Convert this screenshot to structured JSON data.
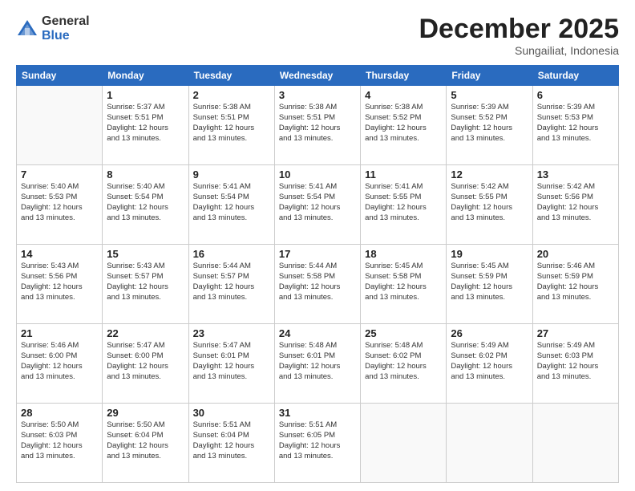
{
  "logo": {
    "general": "General",
    "blue": "Blue"
  },
  "header": {
    "month": "December 2025",
    "location": "Sungailiat, Indonesia"
  },
  "weekdays": [
    "Sunday",
    "Monday",
    "Tuesday",
    "Wednesday",
    "Thursday",
    "Friday",
    "Saturday"
  ],
  "weeks": [
    [
      {
        "day": "",
        "info": ""
      },
      {
        "day": "1",
        "info": "Sunrise: 5:37 AM\nSunset: 5:51 PM\nDaylight: 12 hours\nand 13 minutes."
      },
      {
        "day": "2",
        "info": "Sunrise: 5:38 AM\nSunset: 5:51 PM\nDaylight: 12 hours\nand 13 minutes."
      },
      {
        "day": "3",
        "info": "Sunrise: 5:38 AM\nSunset: 5:51 PM\nDaylight: 12 hours\nand 13 minutes."
      },
      {
        "day": "4",
        "info": "Sunrise: 5:38 AM\nSunset: 5:52 PM\nDaylight: 12 hours\nand 13 minutes."
      },
      {
        "day": "5",
        "info": "Sunrise: 5:39 AM\nSunset: 5:52 PM\nDaylight: 12 hours\nand 13 minutes."
      },
      {
        "day": "6",
        "info": "Sunrise: 5:39 AM\nSunset: 5:53 PM\nDaylight: 12 hours\nand 13 minutes."
      }
    ],
    [
      {
        "day": "7",
        "info": "Sunrise: 5:40 AM\nSunset: 5:53 PM\nDaylight: 12 hours\nand 13 minutes."
      },
      {
        "day": "8",
        "info": "Sunrise: 5:40 AM\nSunset: 5:54 PM\nDaylight: 12 hours\nand 13 minutes."
      },
      {
        "day": "9",
        "info": "Sunrise: 5:41 AM\nSunset: 5:54 PM\nDaylight: 12 hours\nand 13 minutes."
      },
      {
        "day": "10",
        "info": "Sunrise: 5:41 AM\nSunset: 5:54 PM\nDaylight: 12 hours\nand 13 minutes."
      },
      {
        "day": "11",
        "info": "Sunrise: 5:41 AM\nSunset: 5:55 PM\nDaylight: 12 hours\nand 13 minutes."
      },
      {
        "day": "12",
        "info": "Sunrise: 5:42 AM\nSunset: 5:55 PM\nDaylight: 12 hours\nand 13 minutes."
      },
      {
        "day": "13",
        "info": "Sunrise: 5:42 AM\nSunset: 5:56 PM\nDaylight: 12 hours\nand 13 minutes."
      }
    ],
    [
      {
        "day": "14",
        "info": "Sunrise: 5:43 AM\nSunset: 5:56 PM\nDaylight: 12 hours\nand 13 minutes."
      },
      {
        "day": "15",
        "info": "Sunrise: 5:43 AM\nSunset: 5:57 PM\nDaylight: 12 hours\nand 13 minutes."
      },
      {
        "day": "16",
        "info": "Sunrise: 5:44 AM\nSunset: 5:57 PM\nDaylight: 12 hours\nand 13 minutes."
      },
      {
        "day": "17",
        "info": "Sunrise: 5:44 AM\nSunset: 5:58 PM\nDaylight: 12 hours\nand 13 minutes."
      },
      {
        "day": "18",
        "info": "Sunrise: 5:45 AM\nSunset: 5:58 PM\nDaylight: 12 hours\nand 13 minutes."
      },
      {
        "day": "19",
        "info": "Sunrise: 5:45 AM\nSunset: 5:59 PM\nDaylight: 12 hours\nand 13 minutes."
      },
      {
        "day": "20",
        "info": "Sunrise: 5:46 AM\nSunset: 5:59 PM\nDaylight: 12 hours\nand 13 minutes."
      }
    ],
    [
      {
        "day": "21",
        "info": "Sunrise: 5:46 AM\nSunset: 6:00 PM\nDaylight: 12 hours\nand 13 minutes."
      },
      {
        "day": "22",
        "info": "Sunrise: 5:47 AM\nSunset: 6:00 PM\nDaylight: 12 hours\nand 13 minutes."
      },
      {
        "day": "23",
        "info": "Sunrise: 5:47 AM\nSunset: 6:01 PM\nDaylight: 12 hours\nand 13 minutes."
      },
      {
        "day": "24",
        "info": "Sunrise: 5:48 AM\nSunset: 6:01 PM\nDaylight: 12 hours\nand 13 minutes."
      },
      {
        "day": "25",
        "info": "Sunrise: 5:48 AM\nSunset: 6:02 PM\nDaylight: 12 hours\nand 13 minutes."
      },
      {
        "day": "26",
        "info": "Sunrise: 5:49 AM\nSunset: 6:02 PM\nDaylight: 12 hours\nand 13 minutes."
      },
      {
        "day": "27",
        "info": "Sunrise: 5:49 AM\nSunset: 6:03 PM\nDaylight: 12 hours\nand 13 minutes."
      }
    ],
    [
      {
        "day": "28",
        "info": "Sunrise: 5:50 AM\nSunset: 6:03 PM\nDaylight: 12 hours\nand 13 minutes."
      },
      {
        "day": "29",
        "info": "Sunrise: 5:50 AM\nSunset: 6:04 PM\nDaylight: 12 hours\nand 13 minutes."
      },
      {
        "day": "30",
        "info": "Sunrise: 5:51 AM\nSunset: 6:04 PM\nDaylight: 12 hours\nand 13 minutes."
      },
      {
        "day": "31",
        "info": "Sunrise: 5:51 AM\nSunset: 6:05 PM\nDaylight: 12 hours\nand 13 minutes."
      },
      {
        "day": "",
        "info": ""
      },
      {
        "day": "",
        "info": ""
      },
      {
        "day": "",
        "info": ""
      }
    ]
  ]
}
